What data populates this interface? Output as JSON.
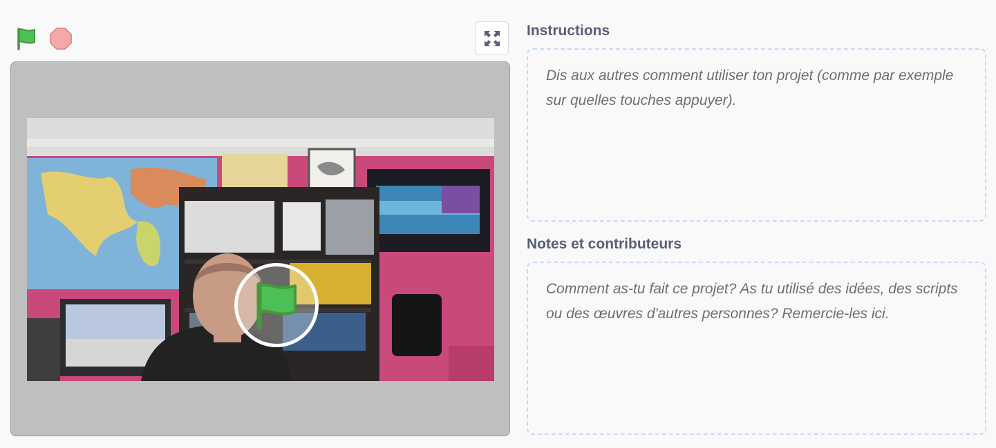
{
  "controls": {
    "green_flag_icon": "green-flag-icon",
    "stop_icon": "stop-icon",
    "fullscreen_icon": "fullscreen-icon",
    "colors": {
      "flag_green": "#4cbf56",
      "flag_dark": "#45993d",
      "stop_fill": "#f5a8a8",
      "stop_stroke": "#e88b8b"
    }
  },
  "stage": {
    "background": "#bfbfbf",
    "overlay_icon": "green-flag-icon"
  },
  "instructions": {
    "title": "Instructions",
    "placeholder": "Dis aux autres comment utiliser ton projet (comme par exemple sur quelles touches appuyer)."
  },
  "notes": {
    "title": "Notes et contributeurs",
    "placeholder": "Comment as-tu fait ce projet? As tu utilisé des idées, des scripts ou des œuvres d'autres personnes? Remercie-les ici."
  }
}
